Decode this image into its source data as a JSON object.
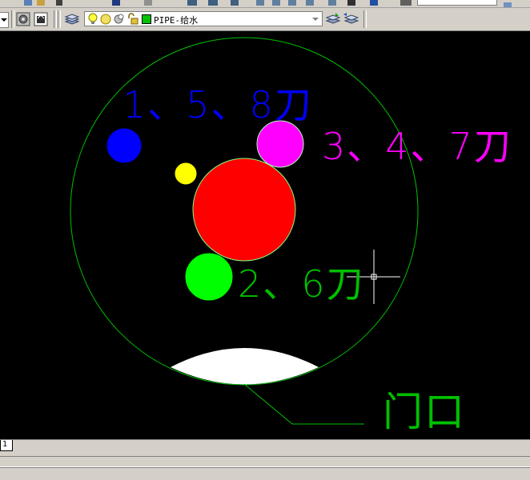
{
  "toolbar": {
    "layer_name": "PIPE-给水",
    "layer_color": "#00c000"
  },
  "drawing": {
    "background": "#000000",
    "labels": {
      "blue": "1、5、8刀",
      "magenta": "3、4、7刀",
      "green": "2、6刀",
      "door": "门口"
    },
    "colors": {
      "outline": "#00c000",
      "blue": "#0000ff",
      "magenta": "#ff00ff",
      "red": "#ff0000",
      "yellow": "#ffff00",
      "green": "#00ff00",
      "arc": "#ffffff",
      "crosshair": "#ffffff"
    }
  },
  "tabs": {
    "layout_tab": "1"
  },
  "icons": [
    "layers-icon",
    "lightbulb-icon",
    "sun-icon",
    "freeze-icon",
    "lock-icon",
    "color-swatch-icon",
    "dropdown-arrow-icon",
    "make-current-icon",
    "layer-previous-icon"
  ]
}
